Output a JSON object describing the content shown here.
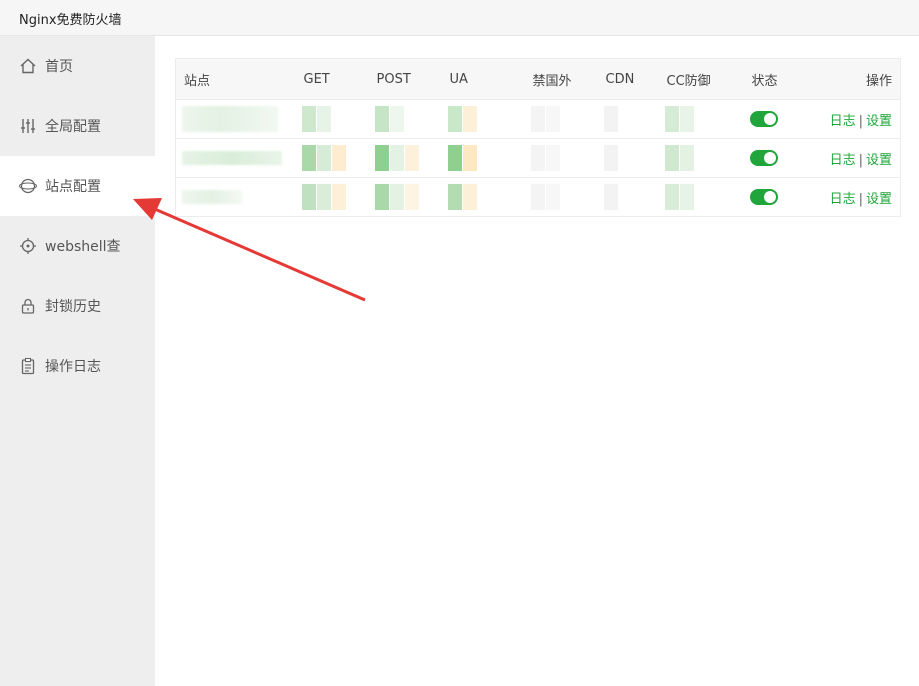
{
  "window": {
    "title": "Nginx免费防火墙"
  },
  "sidebar": {
    "items": [
      {
        "label": "首页",
        "icon": "home-icon"
      },
      {
        "label": "全局配置",
        "icon": "sliders-icon"
      },
      {
        "label": "站点配置",
        "icon": "globe-icon"
      },
      {
        "label": "webshell查",
        "icon": "target-icon"
      },
      {
        "label": "封锁历史",
        "icon": "lock-icon"
      },
      {
        "label": "操作日志",
        "icon": "clipboard-icon"
      }
    ],
    "active_index": 2
  },
  "table": {
    "headers": {
      "site": "站点",
      "get": "GET",
      "post": "POST",
      "ua": "UA",
      "ban_abroad": "禁国外",
      "cdn": "CDN",
      "cc": "CC防御",
      "status": "状态",
      "ops": "操作"
    },
    "rows": [
      {
        "log": "日志",
        "sep": "|",
        "settings": "设置"
      },
      {
        "log": "日志",
        "sep": "|",
        "settings": "设置"
      },
      {
        "log": "日志",
        "sep": "|",
        "settings": "设置"
      }
    ]
  },
  "colors": {
    "accent": "#20a53a",
    "arrow": "#e53935"
  }
}
